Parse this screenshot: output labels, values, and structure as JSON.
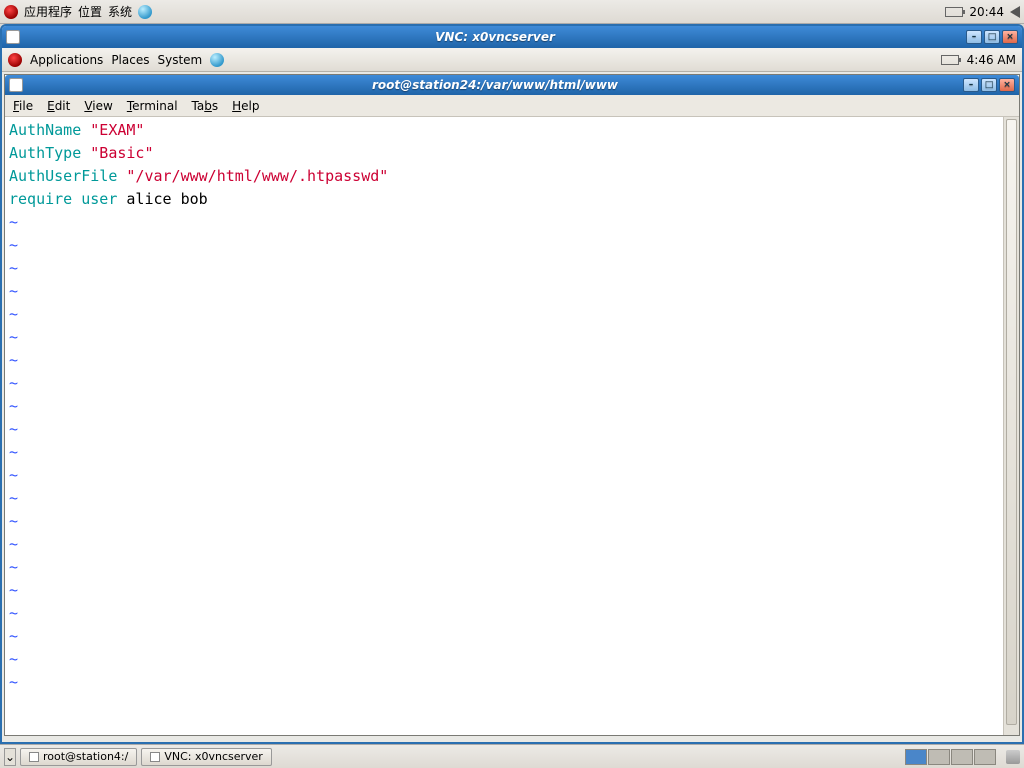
{
  "host_panel": {
    "app_menu": "应用程序",
    "places_menu": "位置",
    "system_menu": "系统",
    "clock": "20:44"
  },
  "vnc_window": {
    "title": "VNC: x0vncserver"
  },
  "gnome_panel": {
    "applications": "Applications",
    "places": "Places",
    "system": "System",
    "clock": "4:46 AM"
  },
  "terminal": {
    "title": "root@station24:/var/www/html/www",
    "menu": {
      "file": "File",
      "edit": "Edit",
      "view": "View",
      "terminal": "Terminal",
      "tabs": "Tabs",
      "help": "Help"
    },
    "content": {
      "l1_kw": "AuthName",
      "l1_str": "\"EXAM\"",
      "l2_kw": "AuthType",
      "l2_str": "\"Basic\"",
      "l3_kw": "AuthUserFile",
      "l3_str": "\"/var/www/html/www/.htpasswd\"",
      "l4_kw": "require user",
      "l4_rest": " alice bob",
      "tilde": "~"
    }
  },
  "taskbar": {
    "btn1": "root@station4:/",
    "btn2": "VNC: x0vncserver"
  }
}
